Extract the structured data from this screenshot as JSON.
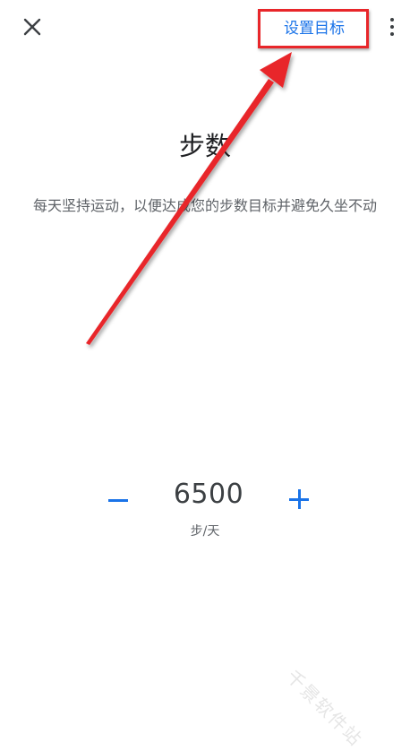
{
  "header": {
    "close_icon": "close-icon",
    "set_goal_label": "设置目标",
    "more_icon": "more-vert-icon"
  },
  "main": {
    "title": "步数",
    "description": "每天坚持运动，以便达成您的步数目标并避免久坐不动"
  },
  "goal": {
    "value": "6500",
    "unit": "步/天",
    "decrement_icon": "minus-icon",
    "increment_icon": "plus-icon"
  },
  "watermark": "千景软件站",
  "colors": {
    "accent": "#1a73e8",
    "annotation_red": "#e8262a"
  }
}
